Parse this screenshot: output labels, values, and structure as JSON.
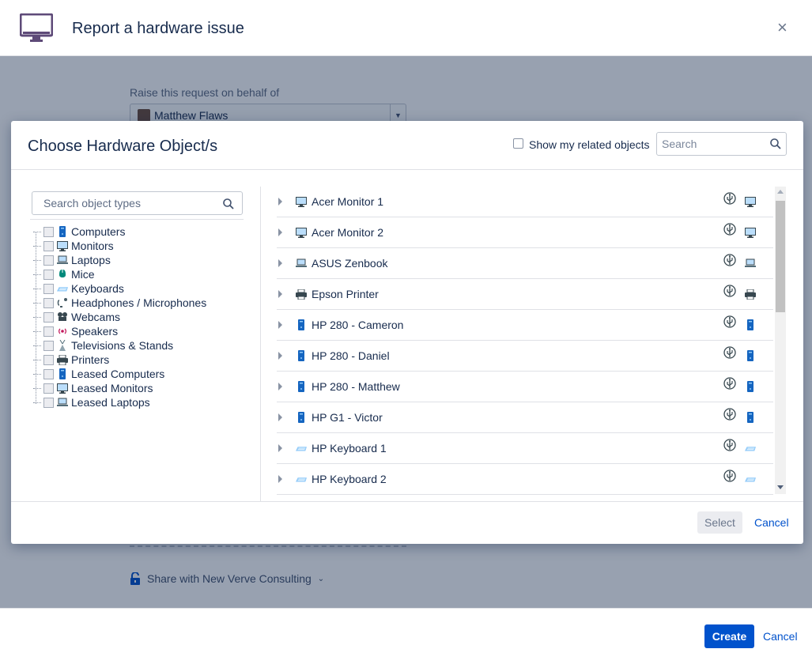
{
  "dialog": {
    "title": "Report a hardware issue",
    "close_icon": "close-icon",
    "on_behalf_label": "Raise this request on behalf of",
    "on_behalf_value": "Matthew Flaws",
    "share_text": "Share with New Verve Consulting",
    "create_label": "Create",
    "cancel_label": "Cancel"
  },
  "modal": {
    "title": "Choose Hardware Object/s",
    "show_related_label": "Show my related objects",
    "search_placeholder": "Search",
    "type_search_placeholder": "Search object types",
    "select_label": "Select",
    "cancel_label": "Cancel"
  },
  "object_types": [
    {
      "label": "Computers",
      "icon": "computer-icon"
    },
    {
      "label": "Monitors",
      "icon": "monitor-icon"
    },
    {
      "label": "Laptops",
      "icon": "laptop-icon"
    },
    {
      "label": "Mice",
      "icon": "mouse-icon"
    },
    {
      "label": "Keyboards",
      "icon": "keyboard-icon"
    },
    {
      "label": "Headphones / Microphones",
      "icon": "microphone-icon"
    },
    {
      "label": "Webcams",
      "icon": "webcam-icon"
    },
    {
      "label": "Speakers",
      "icon": "speaker-icon"
    },
    {
      "label": "Televisions & Stands",
      "icon": "television-icon"
    },
    {
      "label": "Printers",
      "icon": "printer-icon"
    },
    {
      "label": "Leased Computers",
      "icon": "computer-icon"
    },
    {
      "label": "Leased Monitors",
      "icon": "monitor-icon"
    },
    {
      "label": "Leased Laptops",
      "icon": "laptop-icon"
    }
  ],
  "objects": [
    {
      "name": "Acer Monitor 1",
      "icon": "monitor-icon"
    },
    {
      "name": "Acer Monitor 2",
      "icon": "monitor-icon"
    },
    {
      "name": "ASUS Zenbook",
      "icon": "laptop-icon"
    },
    {
      "name": "Epson Printer",
      "icon": "printer-icon"
    },
    {
      "name": "HP 280 - Cameron",
      "icon": "computer-icon"
    },
    {
      "name": "HP 280 - Daniel",
      "icon": "computer-icon"
    },
    {
      "name": "HP 280 - Matthew",
      "icon": "computer-icon"
    },
    {
      "name": "HP G1 - Victor",
      "icon": "computer-icon"
    },
    {
      "name": "HP Keyboard 1",
      "icon": "keyboard-icon"
    },
    {
      "name": "HP Keyboard 2",
      "icon": "keyboard-icon"
    }
  ],
  "colors": {
    "primary": "#0052cc",
    "brand_purple": "#5e4a78",
    "overlay": "#091e42"
  }
}
